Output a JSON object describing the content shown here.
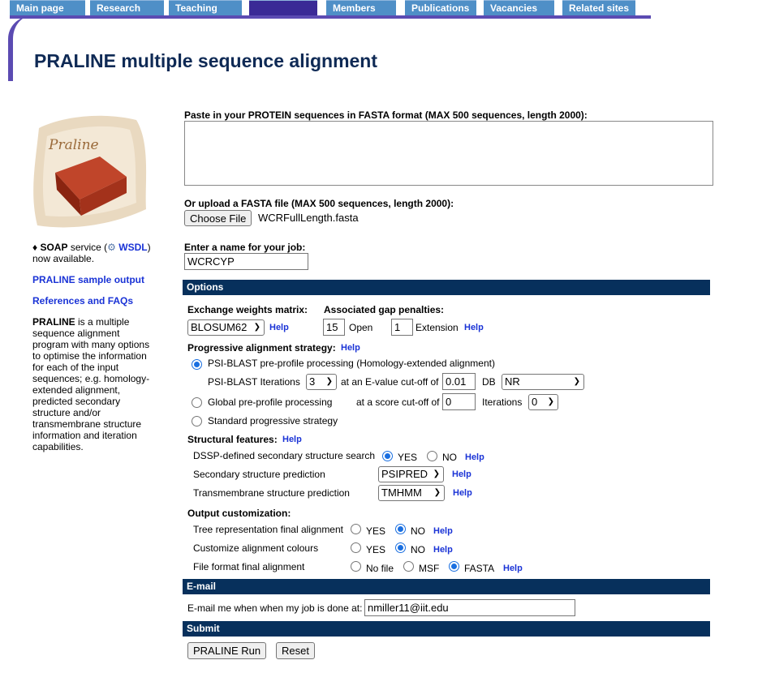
{
  "nav": {
    "tabs": [
      "Main page",
      "Research",
      "Teaching",
      "",
      "Members",
      "Publications",
      "Vacancies",
      "Related sites"
    ]
  },
  "page_title": "PRALINE multiple sequence alignment",
  "sidebar": {
    "logo_text": "Praline",
    "soap_prefix": "♦",
    "soap_bold": "SOAP",
    "soap_text1": "service (",
    "soap_link": "WSDL",
    "soap_text2": ")",
    "soap_text3": "now available.",
    "link_sample": "PRALINE sample output",
    "link_refs": "References and FAQs",
    "desc_bold": "PRALINE",
    "desc_lines": [
      "is a multiple",
      "sequence alignment",
      "program with many options",
      "to optimise the information",
      "for each of the input",
      "sequences; e.g. homology-",
      "extended alignment,",
      "predicted secondary",
      "structure and/or",
      "transmembrane structure",
      "information and iteration",
      "capabilities."
    ]
  },
  "form": {
    "paste_label": "Paste in your PROTEIN sequences in FASTA format (MAX 500 sequences, length 2000):",
    "paste_value": "",
    "upload_label": "Or upload a FASTA file (MAX 500 sequences, length 2000):",
    "choose_file_button": "Choose File",
    "file_name": "WCRFullLength.fasta",
    "job_label": "Enter a name for your job:",
    "job_value": "WCRCYP",
    "options_header": "Options",
    "exchange_label": "Exchange weights matrix:",
    "matrix_value": "BLOSUM62",
    "gap_label": "Associated gap penalties:",
    "gap_open_value": "15",
    "gap_open_label": "Open",
    "gap_ext_value": "1",
    "gap_ext_label": "Extension",
    "help": "Help",
    "progressive_label": "Progressive alignment strategy:",
    "psi_label": "PSI-BLAST pre-profile processing (Homology-extended alignment)",
    "psi_iter_label": "PSI-BLAST Iterations",
    "psi_iter_value": "3",
    "evalue_label": "at an E-value cut-off of",
    "evalue_value": "0.01",
    "db_label": "DB",
    "db_value": "NR",
    "global_label": "Global pre-profile processing",
    "score_label": "at a score cut-off of",
    "score_value": "0",
    "iterations_label": "Iterations",
    "iterations_value": "0",
    "standard_label": "Standard progressive strategy",
    "structural_label": "Structural features:",
    "dssp_label": "DSSP-defined secondary structure search",
    "yes": "YES",
    "no": "NO",
    "ss_pred_label": "Secondary structure prediction",
    "ss_pred_value": "PSIPRED",
    "tm_label": "Transmembrane structure prediction",
    "tm_value": "TMHMM",
    "output_label": "Output customization:",
    "tree_label": "Tree representation final alignment",
    "colours_label": "Customize alignment colours",
    "format_label": "File format final alignment",
    "nofile": "No file",
    "msf": "MSF",
    "fasta": "FASTA",
    "email_header": "E-mail",
    "email_label": "E-mail me when when my job is done at:",
    "email_value": "nmiller11@iit.edu",
    "submit_header": "Submit",
    "run_button": "PRALINE Run",
    "reset_button": "Reset"
  },
  "colors": {
    "nav_tab": "#4f8fc7",
    "nav_active": "#3a2a96",
    "section_bar": "#07305c",
    "link": "#1a33d6",
    "title": "#0f2a55",
    "radio_selected": "#1a6fe0"
  }
}
